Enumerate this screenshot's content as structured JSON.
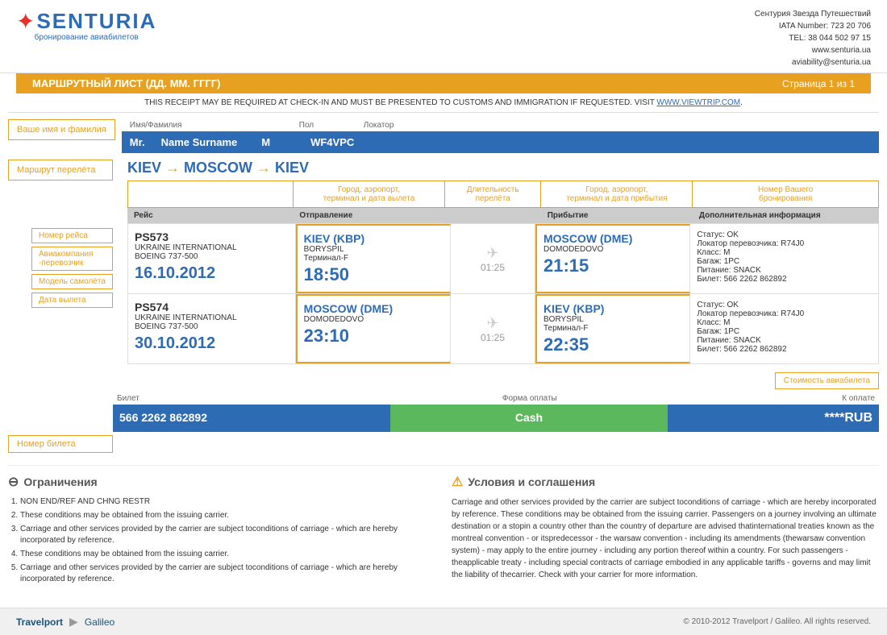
{
  "company": {
    "name": "SENTURIA",
    "sub": "бронирование авиабилетов",
    "info_line1": "Сентурия Звезда Путешествий",
    "info_line2": "IATA Number: 723 20 706",
    "info_line3": "TEL: 38 044 502 97 15",
    "info_line4": "www.senturia.ua",
    "info_line5": "aviability@senturia.ua"
  },
  "title_bar": {
    "left": "МАРШРУТНЫЙ ЛИСТ (ДД. ММ. ГГГГ)",
    "right": "Страница 1 из 1"
  },
  "notice": {
    "text": "THIS RECEIPT MAY BE REQUIRED AT CHECK-IN AND MUST BE PRESENTED TO CUSTOMS AND IMMIGRATION IF REQUESTED. VISIT",
    "link": "WWW.VIEWTRIP.COM",
    "link_url": "#"
  },
  "passenger": {
    "label": "Ваше имя и фамилия",
    "field_name_label": "Имя/Фамилия",
    "field_pol_label": "Пол",
    "field_locator_label": "Локатор",
    "title": "Mr.",
    "name": "Name Surname",
    "pol": "M",
    "locator": "WF4VPC"
  },
  "flight_route": {
    "label": "Маршрут перелёта",
    "route": "KIEV → MOSCOW → KIEV"
  },
  "col_headers": {
    "flight": "Рейс",
    "departure": "Город, аэропорт,\nтерминал и дата вылета",
    "duration": "Длительность перелёта",
    "arrival": "Город, аэропорт,\nтерминал и дата прибытия",
    "info": "Номер Вашего\nбронирования"
  },
  "table_headers_row2": {
    "flight": "Рейс",
    "departure": "Отправление",
    "arrival": "Прибытие",
    "info": "Дополнительная информация"
  },
  "flights": [
    {
      "flight_num": "PS573",
      "airline": "UKRAINE INTERNATIONAL",
      "aircraft": "BOEING 737-500",
      "date": "16.10.2012",
      "dep_airport": "KIEV (KBP)",
      "dep_city": "BORYSPIL",
      "dep_terminal": "Терминал-F",
      "dep_time": "18:50",
      "duration": "01:25",
      "arr_airport": "MOSCOW (DME)",
      "arr_city": "DOMODEDOVO",
      "arr_terminal": "",
      "arr_time": "21:15",
      "status": "Статус: OK",
      "locator": "Локатор перевозчика: R74J0",
      "class": "Класс: M",
      "baggage": "Багаж: 1PC",
      "food": "Питание: SNACK",
      "ticket": "Билет: 566 2262 862892"
    },
    {
      "flight_num": "PS574",
      "airline": "UKRAINE INTERNATIONAL",
      "aircraft": "BOEING 737-500",
      "date": "30.10.2012",
      "dep_airport": "MOSCOW (DME)",
      "dep_city": "DOMODEDOVO",
      "dep_terminal": "",
      "dep_time": "23:10",
      "duration": "01:25",
      "arr_airport": "KIEV (KBP)",
      "arr_city": "BORYSPIL",
      "arr_terminal": "Терминал-F",
      "arr_time": "22:35",
      "status": "Статус: OK",
      "locator": "Локатор перевозчика: R74J0",
      "class": "Класс: M",
      "baggage": "Багаж: 1PC",
      "food": "Питание: SNACK",
      "ticket": "Билет: 566 2262 862892"
    }
  ],
  "annotations": {
    "flight_num_label": "Номер рейса",
    "airline_label": "Авиакомпания\n-перевозчик",
    "aircraft_label": "Модель самолёта",
    "date_label": "Дата вылета"
  },
  "ticket_section": {
    "cost_label": "Стоимость авиабилета",
    "headers": {
      "num": "Билет",
      "pay": "Форма оплаты",
      "amount": "К оплате"
    },
    "num": "566 2262 862892",
    "pay": "Cash",
    "amount": "****RUB",
    "ticket_label": "Номер билета"
  },
  "restrictions": {
    "title": "Ограничения",
    "items": [
      "NON END/REF AND CHNG RESTR",
      "These conditions may be obtained from the issuing carrier.",
      "Carriage and other services provided by the carrier are subject toconditions of carriage - which are hereby incorporated by reference.",
      "These conditions may be obtained from the issuing carrier.",
      "Carriage and other services provided by the carrier are subject toconditions of carriage - which are hereby incorporated by reference."
    ]
  },
  "conditions": {
    "title": "Условия и соглашения",
    "text": "Carriage and other services provided by the carrier are subject toconditions of carriage - which are hereby incorporated by reference. These conditions may be obtained from the issuing carrier. Passengers on a journey involving an ultimate destination or a stopin a country other than the country of departure are advised thatinternational treaties known as the montreal convention - or itspredecessor - the warsaw convention - including its amendments (thewarsaw convention system) - may apply to the entire journey - including any portion thereof within a country. For such passengers - theapplicable treaty - including special contracts of carriage embodied in any applicable tariffs - governs and may limit the liability of thecarrier. Check with your carrier for more information."
  },
  "footer": {
    "copy": "© 2010-2012 Travelport / Galileo. All rights reserved."
  }
}
